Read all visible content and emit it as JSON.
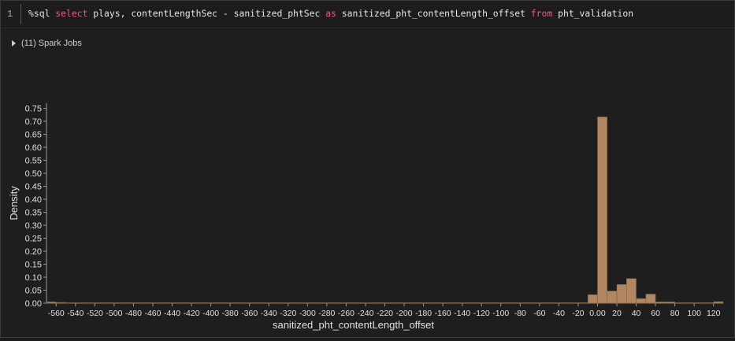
{
  "cell": {
    "line_number": "1",
    "code_tokens": [
      {
        "text": "%sql ",
        "kw": false
      },
      {
        "text": "select",
        "kw": true
      },
      {
        "text": " plays, contentLengthSec - sanitized_phtSec ",
        "kw": false
      },
      {
        "text": "as",
        "kw": true
      },
      {
        "text": " sanitized_pht_contentLength_offset ",
        "kw": false
      },
      {
        "text": "from",
        "kw": true
      },
      {
        "text": " pht_validation",
        "kw": false
      }
    ],
    "spark_jobs_label": "(11) Spark Jobs"
  },
  "colors": {
    "bar_fill": "#b08760",
    "bar_stroke": "#7a5a3c",
    "keyword": "#ff4f8b",
    "axis_text": "#e0e0e0",
    "background": "#1e1e1e"
  },
  "chart_data": {
    "type": "bar",
    "xlabel": "sanitized_pht_contentLength_offset",
    "ylabel": "Density",
    "ylim": [
      0,
      0.77
    ],
    "xlim": [
      -570,
      130
    ],
    "grid": false,
    "y_ticks": [
      "0.00",
      "0.05",
      "0.10",
      "0.15",
      "0.20",
      "0.25",
      "0.30",
      "0.35",
      "0.40",
      "0.45",
      "0.50",
      "0.55",
      "0.60",
      "0.65",
      "0.70",
      "0.75"
    ],
    "x_ticks": [
      "-560",
      "-540",
      "-520",
      "-500",
      "-480",
      "-460",
      "-440",
      "-420",
      "-400",
      "-380",
      "-360",
      "-340",
      "-320",
      "-300",
      "-280",
      "-260",
      "-240",
      "-220",
      "-200",
      "-180",
      "-160",
      "-140",
      "-120",
      "-100",
      "-80",
      "-60",
      "-40",
      "-20",
      "0.00",
      "20",
      "40",
      "60",
      "80",
      "100",
      "120"
    ],
    "bin_width": 10,
    "bins": [
      {
        "x0": -570,
        "density": 0.005
      },
      {
        "x0": -560,
        "density": 0.003
      },
      {
        "x0": -550,
        "density": 0.002
      },
      {
        "x0": -540,
        "density": 0.002
      },
      {
        "x0": -530,
        "density": 0.002
      },
      {
        "x0": -520,
        "density": 0.002
      },
      {
        "x0": -510,
        "density": 0.002
      },
      {
        "x0": -500,
        "density": 0.002
      },
      {
        "x0": -490,
        "density": 0.002
      },
      {
        "x0": -480,
        "density": 0.002
      },
      {
        "x0": -470,
        "density": 0.002
      },
      {
        "x0": -460,
        "density": 0.002
      },
      {
        "x0": -450,
        "density": 0.002
      },
      {
        "x0": -440,
        "density": 0.002
      },
      {
        "x0": -430,
        "density": 0.002
      },
      {
        "x0": -420,
        "density": 0.002
      },
      {
        "x0": -410,
        "density": 0.002
      },
      {
        "x0": -400,
        "density": 0.002
      },
      {
        "x0": -390,
        "density": 0.002
      },
      {
        "x0": -380,
        "density": 0.002
      },
      {
        "x0": -370,
        "density": 0.002
      },
      {
        "x0": -360,
        "density": 0.002
      },
      {
        "x0": -350,
        "density": 0.002
      },
      {
        "x0": -340,
        "density": 0.002
      },
      {
        "x0": -330,
        "density": 0.002
      },
      {
        "x0": -320,
        "density": 0.002
      },
      {
        "x0": -310,
        "density": 0.002
      },
      {
        "x0": -300,
        "density": 0.002
      },
      {
        "x0": -290,
        "density": 0.002
      },
      {
        "x0": -280,
        "density": 0.002
      },
      {
        "x0": -270,
        "density": 0.002
      },
      {
        "x0": -260,
        "density": 0.002
      },
      {
        "x0": -250,
        "density": 0.002
      },
      {
        "x0": -240,
        "density": 0.002
      },
      {
        "x0": -230,
        "density": 0.002
      },
      {
        "x0": -220,
        "density": 0.002
      },
      {
        "x0": -210,
        "density": 0.002
      },
      {
        "x0": -200,
        "density": 0.002
      },
      {
        "x0": -190,
        "density": 0.002
      },
      {
        "x0": -180,
        "density": 0.002
      },
      {
        "x0": -170,
        "density": 0.002
      },
      {
        "x0": -160,
        "density": 0.002
      },
      {
        "x0": -150,
        "density": 0.002
      },
      {
        "x0": -140,
        "density": 0.002
      },
      {
        "x0": -130,
        "density": 0.002
      },
      {
        "x0": -120,
        "density": 0.002
      },
      {
        "x0": -110,
        "density": 0.002
      },
      {
        "x0": -100,
        "density": 0.002
      },
      {
        "x0": -90,
        "density": 0.002
      },
      {
        "x0": -80,
        "density": 0.002
      },
      {
        "x0": -70,
        "density": 0.002
      },
      {
        "x0": -60,
        "density": 0.002
      },
      {
        "x0": -50,
        "density": 0.002
      },
      {
        "x0": -40,
        "density": 0.002
      },
      {
        "x0": -30,
        "density": 0.002
      },
      {
        "x0": -20,
        "density": 0.002
      },
      {
        "x0": -10,
        "density": 0.033
      },
      {
        "x0": 0,
        "density": 0.717
      },
      {
        "x0": 10,
        "density": 0.047
      },
      {
        "x0": 20,
        "density": 0.072
      },
      {
        "x0": 30,
        "density": 0.095
      },
      {
        "x0": 40,
        "density": 0.018
      },
      {
        "x0": 50,
        "density": 0.035
      },
      {
        "x0": 60,
        "density": 0.005
      },
      {
        "x0": 70,
        "density": 0.005
      },
      {
        "x0": 80,
        "density": 0.002
      },
      {
        "x0": 90,
        "density": 0.002
      },
      {
        "x0": 100,
        "density": 0.002
      },
      {
        "x0": 110,
        "density": 0.002
      },
      {
        "x0": 120,
        "density": 0.006
      }
    ]
  }
}
